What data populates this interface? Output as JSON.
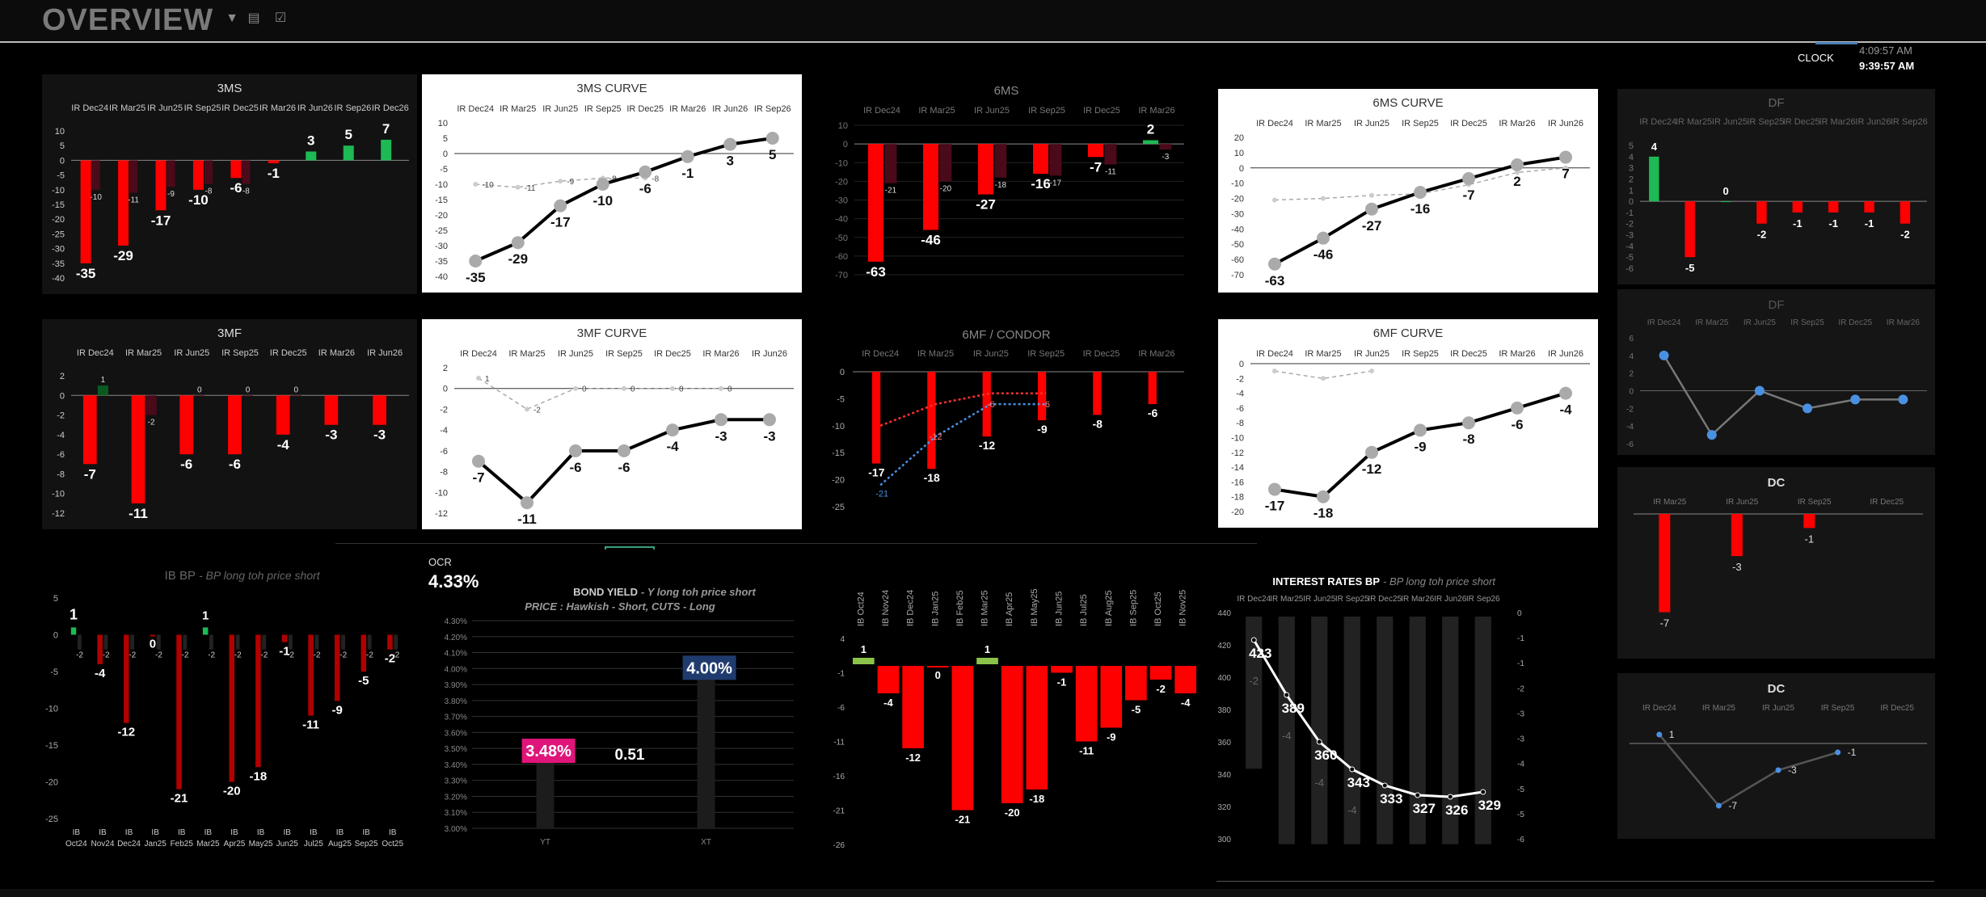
{
  "header": {
    "title": "OVERVIEW",
    "icons": [
      "filter-dropdown-icon",
      "list-icon",
      "checklist-icon"
    ],
    "clock_label": "CLOCK",
    "time1": "4:09:57 AM",
    "time2": "9:39:57 AM"
  },
  "colors": {
    "red": "#ff0000",
    "dark_red": "#4a0a1a",
    "green": "#1db954",
    "white": "#ffffff",
    "dark_panel": "#151515",
    "blue_dot": "#4a90e2"
  },
  "chart_data": [
    {
      "id": "3ms",
      "type": "bar",
      "title": "3MS",
      "categories": [
        "IR Dec24",
        "IR Mar25",
        "IR Jun25",
        "IR Sep25",
        "IR Dec25",
        "IR Mar26",
        "IR Jun26",
        "IR Sep26",
        "IR Dec26"
      ],
      "series": [
        {
          "values": [
            -35,
            -29,
            -17,
            -10,
            -6,
            -1,
            3,
            5,
            7
          ]
        },
        {
          "values": [
            -10,
            -11,
            -9,
            -8,
            -8,
            null,
            null,
            null,
            null
          ]
        }
      ],
      "ylim": [
        -40,
        10
      ],
      "yticks": [
        10,
        5,
        0,
        -5,
        -10,
        -15,
        -20,
        -25,
        -30,
        -35,
        -40
      ]
    },
    {
      "id": "3ms-curve",
      "type": "line",
      "title": "3MS CURVE",
      "categories": [
        "IR Dec24",
        "IR Mar25",
        "IR Jun25",
        "IR Sep25",
        "IR Dec25",
        "IR Mar26",
        "IR Jun26",
        "IR Sep26"
      ],
      "series": [
        {
          "values": [
            -35,
            -29,
            -17,
            -10,
            -6,
            -1,
            3,
            5
          ]
        },
        {
          "values": [
            -10,
            -11,
            -9,
            -8,
            -8,
            null,
            null,
            null
          ]
        }
      ],
      "ylim": [
        -40,
        10
      ],
      "yticks": [
        10,
        5,
        0,
        -5,
        -10,
        -15,
        -20,
        -25,
        -30,
        -35,
        -40
      ]
    },
    {
      "id": "6ms",
      "type": "bar",
      "title": "6MS",
      "categories": [
        "IR Dec24",
        "IR Mar25",
        "IR Jun25",
        "IR Sep25",
        "IR Dec25",
        "IR Mar26"
      ],
      "series": [
        {
          "values": [
            -63,
            -46,
            -27,
            -16,
            -7,
            2
          ]
        },
        {
          "values": [
            -21,
            -20,
            -18,
            -17,
            -11,
            -3
          ]
        }
      ],
      "ylim": [
        -70,
        10
      ],
      "yticks": [
        10,
        0,
        -10,
        -20,
        -30,
        -40,
        -50,
        -60,
        -70
      ]
    },
    {
      "id": "6ms-curve",
      "type": "line",
      "title": "6MS CURVE",
      "categories": [
        "IR Dec24",
        "IR Mar25",
        "IR Jun25",
        "IR Sep25",
        "IR Dec25",
        "IR Mar26",
        "IR Jun26"
      ],
      "series": [
        {
          "values": [
            -63,
            -46,
            -27,
            -16,
            -7,
            2,
            7
          ]
        },
        {
          "values": [
            -21,
            -20,
            -18,
            -17,
            -11,
            -3,
            0
          ]
        }
      ],
      "ylim": [
        -70,
        20
      ],
      "yticks": [
        20,
        10,
        0,
        -10,
        -20,
        -30,
        -40,
        -50,
        -60,
        -70
      ]
    },
    {
      "id": "df1",
      "type": "bar",
      "title": "DF",
      "categories": [
        "IR Dec24",
        "IR Mar25",
        "IR Jun25",
        "IR Sep25",
        "IR Dec25",
        "IR Mar26",
        "IR Jun26",
        "IR Sep26"
      ],
      "series": [
        {
          "values": [
            4,
            -5,
            0,
            -2,
            -1,
            -1,
            -1,
            -2
          ]
        }
      ],
      "ylim": [
        -6,
        5
      ],
      "yticks": [
        5,
        4,
        3,
        2,
        1,
        0,
        -1,
        -2,
        -3,
        -4,
        -5,
        -6
      ]
    },
    {
      "id": "3mf",
      "type": "bar",
      "title": "3MF",
      "categories": [
        "IR Dec24",
        "IR Mar25",
        "IR Jun25",
        "IR Sep25",
        "IR Dec25",
        "IR Mar26",
        "IR Jun26"
      ],
      "series": [
        {
          "values": [
            -7,
            -11,
            -6,
            -6,
            -4,
            -3,
            -3
          ]
        },
        {
          "values": [
            1,
            -2,
            0,
            0,
            0,
            null,
            null
          ]
        }
      ],
      "ylim": [
        -12,
        2
      ],
      "yticks": [
        2,
        0,
        -2,
        -4,
        -6,
        -8,
        -10,
        -12
      ]
    },
    {
      "id": "3mf-curve",
      "type": "line",
      "title": "3MF CURVE",
      "categories": [
        "IR Dec24",
        "IR Mar25",
        "IR Jun25",
        "IR Sep25",
        "IR Dec25",
        "IR Mar26",
        "IR Jun26"
      ],
      "series": [
        {
          "values": [
            -7,
            -11,
            -6,
            -6,
            -4,
            -3,
            -3
          ]
        },
        {
          "values": [
            1,
            -2,
            0,
            0,
            0,
            0,
            null
          ]
        }
      ],
      "ylim": [
        -12,
        2
      ],
      "yticks": [
        2,
        0,
        -2,
        -4,
        -6,
        -8,
        -10,
        -12
      ]
    },
    {
      "id": "6mf",
      "type": "bar",
      "title": "6MF / CONDOR",
      "categories": [
        "IR Dec24",
        "IR Mar25",
        "IR Jun25",
        "IR Sep25",
        "IR Dec25",
        "IR Mar26"
      ],
      "series": [
        {
          "values": [
            -17,
            -18,
            -12,
            -9,
            -8,
            -6
          ]
        },
        {
          "values": [
            -21,
            -12,
            -6,
            -6,
            null,
            null
          ]
        },
        {
          "values": [
            -10,
            -6,
            -4,
            -4,
            null,
            null
          ]
        }
      ],
      "ylim": [
        -25,
        0
      ],
      "yticks": [
        0,
        -5,
        -10,
        -15,
        -20,
        -25
      ]
    },
    {
      "id": "6mf-curve",
      "type": "line",
      "title": "6MF CURVE",
      "categories": [
        "IR Dec24",
        "IR Mar25",
        "IR Jun25",
        "IR Sep25",
        "IR Dec25",
        "IR Mar26",
        "IR Jun26"
      ],
      "series": [
        {
          "values": [
            -17,
            -18,
            -12,
            -9,
            -8,
            -6,
            -4
          ]
        },
        {
          "values": [
            -1,
            -2,
            -1,
            null,
            null,
            null,
            null
          ]
        }
      ],
      "ylim": [
        -20,
        0
      ],
      "yticks": [
        0,
        -2,
        -4,
        -6,
        -8,
        -10,
        -12,
        -14,
        -16,
        -18,
        -20
      ]
    },
    {
      "id": "df2",
      "type": "line",
      "title": "DF",
      "categories": [
        "IR Dec24",
        "IR Mar25",
        "IR Jun25",
        "IR Sep25",
        "IR Dec25",
        "IR Mar26"
      ],
      "series": [
        {
          "values": [
            4,
            -5,
            0,
            -2,
            -1,
            -1
          ]
        }
      ],
      "ylim": [
        -6,
        6
      ],
      "yticks": [
        6,
        4,
        2,
        0,
        -2,
        -4,
        -6
      ]
    },
    {
      "id": "dc1",
      "type": "bar",
      "title": "DC",
      "categories": [
        "IR Mar25",
        "IR Jun25",
        "IR Sep25",
        "IR Dec25"
      ],
      "series": [
        {
          "values": [
            -7,
            -3,
            -1,
            null
          ]
        }
      ],
      "ylim": [
        -8,
        0
      ]
    },
    {
      "id": "dc2",
      "type": "line",
      "title": "DC",
      "categories": [
        "IR Dec24",
        "IR Mar25",
        "IR Jun25",
        "IR Sep25",
        "IR Dec25"
      ],
      "series": [
        {
          "values": [
            1,
            -7,
            -3,
            -1,
            null
          ]
        }
      ],
      "ylim": [
        -8,
        2
      ]
    },
    {
      "id": "ib-bp",
      "type": "bar",
      "title": "IB BP",
      "subtitle": "- BP long toh price short",
      "categories": [
        "IB Oct24",
        "IB Nov24",
        "IB Dec24",
        "IB Jan25",
        "IB Feb25",
        "IB Mar25",
        "IB Apr25",
        "IB May25",
        "IB Jun25",
        "IB Jul25",
        "IB Aug25",
        "IB Sep25",
        "IB Oct25"
      ],
      "series": [
        {
          "values": [
            1,
            -4,
            -12,
            0,
            -21,
            1,
            -20,
            -18,
            -1,
            -11,
            -9,
            -5,
            -2
          ]
        },
        {
          "values": [
            -2,
            -2,
            -2,
            -2,
            -2,
            -2,
            -2,
            -2,
            -2,
            -2,
            -2,
            -2,
            -2
          ]
        }
      ],
      "ylim": [
        -25,
        5
      ],
      "yticks": [
        5,
        0,
        -5,
        -10,
        -15,
        -20,
        -25
      ]
    },
    {
      "id": "bond-yield",
      "type": "bar",
      "title": "BOND YIELD",
      "subtitle": "- Y long toh price short",
      "line2": "PRICE : Hawkish - Short, CUTS - Long",
      "ocr_label": "OCR",
      "ocr_value": "4.33%",
      "categories": [
        "YT",
        "XT"
      ],
      "values": [
        3.48,
        4.0
      ],
      "value_labels": [
        "3.48%",
        "4.00%"
      ],
      "spread_label": "0.51",
      "ylim": [
        3.0,
        4.3
      ],
      "yticks": [
        "4.30%",
        "4.20%",
        "4.10%",
        "4.00%",
        "3.90%",
        "3.80%",
        "3.70%",
        "3.60%",
        "3.50%",
        "3.40%",
        "3.30%",
        "3.20%",
        "3.10%",
        "3.00%"
      ]
    },
    {
      "id": "ib-wide",
      "type": "bar",
      "categories": [
        "IB Oct24",
        "IB Nov24",
        "IB Dec24",
        "IB Jan25",
        "IB Feb25",
        "IB Mar25",
        "IB Apr25",
        "IB May25",
        "IB Jun25",
        "IB Jul25",
        "IB Aug25",
        "IB Sep25",
        "IB Oct25",
        "IB Nov25"
      ],
      "series": [
        {
          "values": [
            1,
            -4,
            -12,
            0,
            -21,
            1,
            -20,
            -18,
            -1,
            -11,
            -9,
            -5,
            -2,
            -4
          ]
        }
      ],
      "ylim": [
        -26,
        4
      ],
      "yticks": [
        4,
        -1,
        -6,
        -11,
        -16,
        -21,
        -26
      ]
    },
    {
      "id": "interest-rates",
      "type": "bar",
      "title": "INTEREST RATES BP",
      "subtitle": "- BP long toh price short",
      "categories": [
        "IR Dec24",
        "IR Mar25",
        "IR Jun25",
        "IR Sep25",
        "IR Dec25",
        "IR Mar26",
        "IR Jun26",
        "IR Sep26"
      ],
      "line_values": [
        423,
        389,
        360,
        343,
        333,
        327,
        326,
        329
      ],
      "bar_values": [
        -2,
        -4,
        -4,
        -4,
        -4,
        -4,
        -4,
        -4
      ],
      "bar_labels": [
        "-2",
        "-4",
        "-4",
        "-4",
        "",
        "",
        "",
        ""
      ],
      "ylim_left": [
        300,
        440
      ],
      "yticks_left": [
        440,
        420,
        400,
        380,
        360,
        340,
        320,
        300
      ],
      "ylim_right": [
        -6,
        0
      ],
      "yticks_right": [
        0,
        -1,
        -1,
        -2,
        -3,
        -3,
        -4,
        -5,
        -5,
        -6
      ]
    }
  ]
}
